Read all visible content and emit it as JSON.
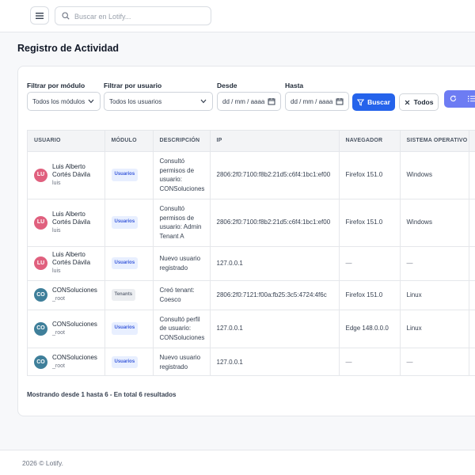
{
  "topbar": {
    "menu_icon": "hamburger-icon",
    "search_icon": "search-icon",
    "search_placeholder": "Buscar en Lotify..."
  },
  "page": {
    "title": "Registro de Actividad"
  },
  "filters": {
    "module": {
      "label": "Filtrar por módulo",
      "value": "Todos los módulos"
    },
    "user": {
      "label": "Filtrar por usuario",
      "value": "Todos los usuarios"
    },
    "from": {
      "label": "Desde",
      "value": "dd / mm / aaaa"
    },
    "to": {
      "label": "Hasta",
      "value": "dd / mm / aaaa"
    },
    "search_button": "Buscar",
    "clear_button": "Todos"
  },
  "colors": {
    "primary": "#2563eb",
    "group_button": "#6d7cf3",
    "avatar_lu": "#e0607e",
    "avatar_co": "#3f7f9a",
    "badge_usuarios_bg": "#e8efff",
    "badge_usuarios_fg": "#3b5bdb",
    "badge_tenants_bg": "#eceef1",
    "badge_tenants_fg": "#6b7280"
  },
  "table": {
    "headers": [
      "USUARIO",
      "MÓDULO",
      "DESCRIPCIÓN",
      "IP",
      "NAVEGADOR",
      "SISTEMA OPERATIVO"
    ],
    "rows": [
      {
        "initials": "LU",
        "name": "Luis Alberto Cortés Dávila",
        "login": "luis",
        "module": "Usuarios",
        "description": "Consultó permisos de usuario: CONSoluciones",
        "ip": "2806:2f0:7100:f8b2:21d5:c6f4:1bc1:ef00",
        "browser": "Firefox 151.0",
        "os": "Windows"
      },
      {
        "initials": "LU",
        "name": "Luis Alberto Cortés Dávila",
        "login": "luis",
        "module": "Usuarios",
        "description": "Consultó permisos de usuario: Admin Tenant A",
        "ip": "2806:2f0:7100:f8b2:21d5:c6f4:1bc1:ef00",
        "browser": "Firefox 151.0",
        "os": "Windows"
      },
      {
        "initials": "LU",
        "name": "Luis Alberto Cortés Dávila",
        "login": "luis",
        "module": "Usuarios",
        "description": "Nuevo usuario registrado",
        "ip": "127.0.0.1",
        "browser": "—",
        "os": "—"
      },
      {
        "initials": "CO",
        "name": "CONSoluciones",
        "login": "_root",
        "module": "Tenants",
        "description": "Creó tenant: Coesco",
        "ip": "2806:2f0:7121:f00a:fb25:3c5:4724:4f6c",
        "browser": "Firefox 151.0",
        "os": "Linux"
      },
      {
        "initials": "CO",
        "name": "CONSoluciones",
        "login": "_root",
        "module": "Usuarios",
        "description": "Consultó perfil de usuario: CONSoluciones",
        "ip": "127.0.0.1",
        "browser": "Edge 148.0.0.0",
        "os": "Linux"
      },
      {
        "initials": "CO",
        "name": "CONSoluciones",
        "login": "_root",
        "module": "Usuarios",
        "description": "Nuevo usuario registrado",
        "ip": "127.0.0.1",
        "browser": "—",
        "os": "—"
      }
    ]
  },
  "summary": "Mostrando desde 1 hasta 6 - En total 6 resultados",
  "footer": {
    "copyright": "2026 © Lotify."
  }
}
